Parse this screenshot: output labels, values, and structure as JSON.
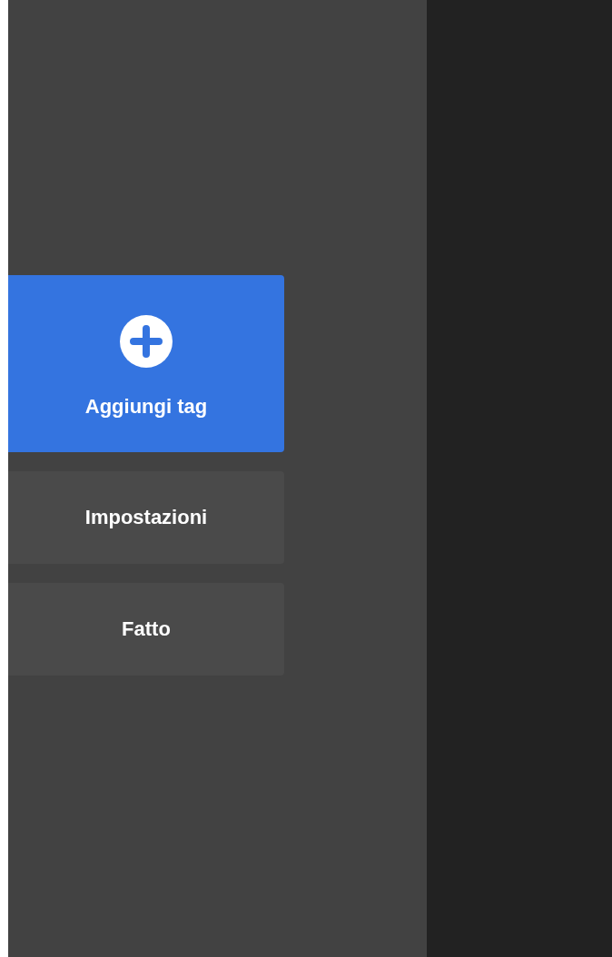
{
  "buttons": [
    {
      "kind": "primary",
      "label": "Aggiungi tag"
    },
    {
      "kind": "secondary",
      "label": "Impostazioni"
    },
    {
      "kind": "secondary",
      "label": "Fatto"
    }
  ]
}
